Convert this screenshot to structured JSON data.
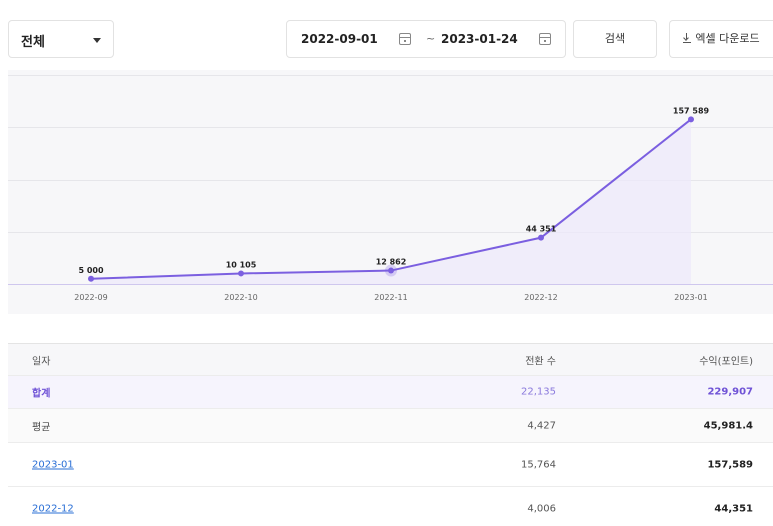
{
  "filter": {
    "selected": "전체",
    "caret_icon": "chevron-down-icon"
  },
  "date_range": {
    "start": "2022-09-01",
    "separator": "~",
    "end": "2023-01-24",
    "icon": "calendar-icon"
  },
  "buttons": {
    "search_label": "검색",
    "excel_label": "엑셀 다운로드",
    "excel_icon": "download-icon"
  },
  "colors": {
    "accent": "#7b5fe0",
    "fill": "#ece8fb"
  },
  "chart_data": {
    "type": "line",
    "x": [
      "2022-09",
      "2022-10",
      "2022-11",
      "2022-12",
      "2023-01"
    ],
    "series": [
      {
        "values": [
          5000,
          10105,
          12862,
          44351,
          157589
        ]
      }
    ],
    "data_labels": [
      "5 000",
      "10 105",
      "12 862",
      "44 351",
      "157 589"
    ],
    "ylim": [
      0,
      200000
    ],
    "grid": true,
    "highlighted_point": "2022-11",
    "title": "",
    "xlabel": "",
    "ylabel": ""
  },
  "table": {
    "headers": {
      "date": "일자",
      "conversions": "전환 수",
      "revenue": "수익(포인트)"
    },
    "total": {
      "label": "합계",
      "conversions": "22,135",
      "revenue": "229,907"
    },
    "average": {
      "label": "평균",
      "conversions": "4,427",
      "revenue": "45,981.4"
    },
    "rows": [
      {
        "date": "2023-01",
        "conversions": "15,764",
        "revenue": "157,589"
      },
      {
        "date": "2022-12",
        "conversions": "4,006",
        "revenue": "44,351"
      }
    ]
  }
}
